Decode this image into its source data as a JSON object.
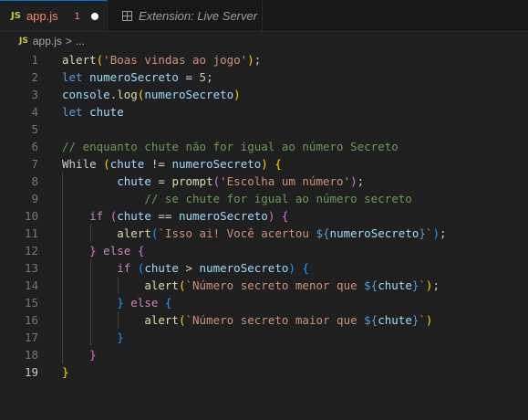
{
  "tabs": [
    {
      "icon": "JS",
      "label": "app.js",
      "problems": "1",
      "active": true
    },
    {
      "label": "Extension: Live Server",
      "active": false
    }
  ],
  "breadcrumb": {
    "icon": "JS",
    "file": "app.js",
    "sep": ">",
    "more": "..."
  },
  "editor": {
    "current_line": 19,
    "lines": [
      {
        "n": "1",
        "tokens": [
          [
            "alert",
            "fn"
          ],
          [
            "(",
            "p1"
          ],
          [
            "'Boas vindas ao jogo'",
            "str"
          ],
          [
            ")",
            "p1"
          ],
          [
            ";",
            "txt"
          ]
        ]
      },
      {
        "n": "2",
        "tokens": [
          [
            "let ",
            "kw"
          ],
          [
            "numeroSecreto",
            "var"
          ],
          [
            " = ",
            "op"
          ],
          [
            "5",
            "num"
          ],
          [
            ";",
            "txt"
          ]
        ]
      },
      {
        "n": "3",
        "tokens": [
          [
            "console",
            "var"
          ],
          [
            ".",
            "txt"
          ],
          [
            "log",
            "fn"
          ],
          [
            "(",
            "p1"
          ],
          [
            "numeroSecreto",
            "var"
          ],
          [
            ")",
            "p1"
          ]
        ]
      },
      {
        "n": "4",
        "tokens": [
          [
            "let ",
            "kw"
          ],
          [
            "chute",
            "var"
          ]
        ]
      },
      {
        "n": "5",
        "tokens": []
      },
      {
        "n": "6",
        "tokens": [
          [
            "// enquanto chute não for igual ao número Secreto",
            "cm"
          ]
        ]
      },
      {
        "n": "7",
        "tokens": [
          [
            "While ",
            "txt"
          ],
          [
            "(",
            "p1"
          ],
          [
            "chute",
            "var"
          ],
          [
            " != ",
            "op"
          ],
          [
            "numeroSecreto",
            "var"
          ],
          [
            ")",
            "p1"
          ],
          [
            " ",
            "txt"
          ],
          [
            "{",
            "p1"
          ]
        ]
      },
      {
        "n": "8",
        "tokens": [
          [
            "        ",
            "txt"
          ],
          [
            "chute",
            "var"
          ],
          [
            " = ",
            "op"
          ],
          [
            "prompt",
            "fn"
          ],
          [
            "(",
            "p2"
          ],
          [
            "'Escolha um número'",
            "str"
          ],
          [
            ")",
            "p2"
          ],
          [
            ";",
            "txt"
          ]
        ]
      },
      {
        "n": "9",
        "tokens": [
          [
            "            ",
            "txt"
          ],
          [
            "// se chute for igual ao número secreto",
            "cm"
          ]
        ]
      },
      {
        "n": "10",
        "tokens": [
          [
            "    ",
            "txt"
          ],
          [
            "if ",
            "ctl"
          ],
          [
            "(",
            "p2"
          ],
          [
            "chute",
            "var"
          ],
          [
            " == ",
            "op"
          ],
          [
            "numeroSecreto",
            "var"
          ],
          [
            ")",
            "p2"
          ],
          [
            " ",
            "txt"
          ],
          [
            "{",
            "p2"
          ]
        ]
      },
      {
        "n": "11",
        "tokens": [
          [
            "        ",
            "txt"
          ],
          [
            "alert",
            "fn"
          ],
          [
            "(",
            "p3"
          ],
          [
            "`Isso ai! Você acertou ",
            "str"
          ],
          [
            "${",
            "tpl"
          ],
          [
            "numeroSecreto",
            "var"
          ],
          [
            "}",
            "tpl"
          ],
          [
            "`",
            "str"
          ],
          [
            ")",
            "p3"
          ],
          [
            ";",
            "txt"
          ]
        ]
      },
      {
        "n": "12",
        "tokens": [
          [
            "    ",
            "txt"
          ],
          [
            "}",
            "p2"
          ],
          [
            " ",
            "txt"
          ],
          [
            "else ",
            "ctl"
          ],
          [
            "{",
            "p2"
          ]
        ]
      },
      {
        "n": "13",
        "tokens": [
          [
            "        ",
            "txt"
          ],
          [
            "if ",
            "ctl"
          ],
          [
            "(",
            "p3"
          ],
          [
            "chute",
            "var"
          ],
          [
            " > ",
            "op"
          ],
          [
            "numeroSecreto",
            "var"
          ],
          [
            ")",
            "p3"
          ],
          [
            " ",
            "txt"
          ],
          [
            "{",
            "p3"
          ]
        ]
      },
      {
        "n": "14",
        "tokens": [
          [
            "            ",
            "txt"
          ],
          [
            "alert",
            "fn"
          ],
          [
            "(",
            "p1"
          ],
          [
            "`Número secreto menor que ",
            "str"
          ],
          [
            "${",
            "tpl"
          ],
          [
            "chute",
            "var"
          ],
          [
            "}",
            "tpl"
          ],
          [
            "`",
            "str"
          ],
          [
            ")",
            "p1"
          ],
          [
            ";",
            "txt"
          ]
        ]
      },
      {
        "n": "15",
        "tokens": [
          [
            "        ",
            "txt"
          ],
          [
            "}",
            "p3"
          ],
          [
            " ",
            "txt"
          ],
          [
            "else ",
            "ctl"
          ],
          [
            "{",
            "p3"
          ]
        ]
      },
      {
        "n": "16",
        "tokens": [
          [
            "            ",
            "txt"
          ],
          [
            "alert",
            "fn"
          ],
          [
            "(",
            "p1"
          ],
          [
            "`Número secreto maior que ",
            "str"
          ],
          [
            "${",
            "tpl"
          ],
          [
            "chute",
            "var"
          ],
          [
            "}",
            "tpl"
          ],
          [
            "`",
            "str"
          ],
          [
            ")",
            "p1"
          ]
        ]
      },
      {
        "n": "17",
        "tokens": [
          [
            "        ",
            "txt"
          ],
          [
            "}",
            "p3"
          ]
        ]
      },
      {
        "n": "18",
        "tokens": [
          [
            "    ",
            "txt"
          ],
          [
            "}",
            "p2"
          ]
        ]
      },
      {
        "n": "19",
        "tokens": [
          [
            "}",
            "p1"
          ]
        ]
      }
    ]
  },
  "colors": {
    "background": "#1f1f1f",
    "tab_active_border": "#0078d4",
    "error_text": "#f48771",
    "js_badge": "#cbcb41"
  }
}
